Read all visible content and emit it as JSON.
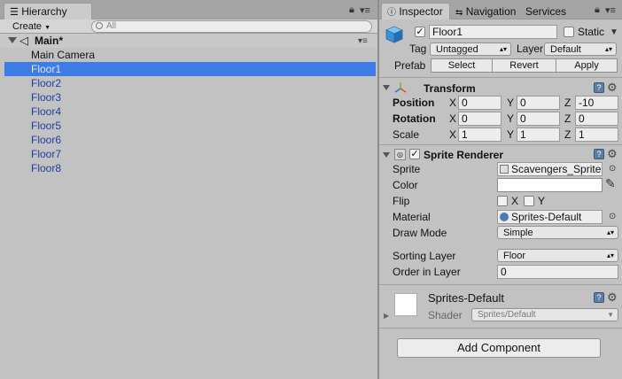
{
  "hierarchy": {
    "tab_label": "Hierarchy",
    "create_label": "Create",
    "search_placeholder": "All",
    "scene_name": "Main*",
    "items": [
      {
        "label": "Main Camera",
        "state": "normal"
      },
      {
        "label": "Floor1",
        "state": "selected"
      },
      {
        "label": "Floor2",
        "state": "prefab"
      },
      {
        "label": "Floor3",
        "state": "prefab"
      },
      {
        "label": "Floor4",
        "state": "prefab"
      },
      {
        "label": "Floor5",
        "state": "prefab"
      },
      {
        "label": "Floor6",
        "state": "prefab"
      },
      {
        "label": "Floor7",
        "state": "prefab"
      },
      {
        "label": "Floor8",
        "state": "prefab"
      }
    ]
  },
  "inspector": {
    "tabs": {
      "inspector": "Inspector",
      "navigation": "Navigation",
      "services": "Services"
    },
    "object": {
      "name": "Floor1",
      "static_label": "Static",
      "tag_label": "Tag",
      "tag_value": "Untagged",
      "layer_label": "Layer",
      "layer_value": "Default",
      "prefab_label": "Prefab",
      "prefab_select": "Select",
      "prefab_revert": "Revert",
      "prefab_apply": "Apply"
    },
    "transform": {
      "title": "Transform",
      "position_label": "Position",
      "rotation_label": "Rotation",
      "scale_label": "Scale",
      "x": "X",
      "y": "Y",
      "z": "Z",
      "position": {
        "x": "0",
        "y": "0",
        "z": "-10"
      },
      "rotation": {
        "x": "0",
        "y": "0",
        "z": "0"
      },
      "scale": {
        "x": "1",
        "y": "1",
        "z": "1"
      }
    },
    "sprite_renderer": {
      "title": "Sprite Renderer",
      "sprite_label": "Sprite",
      "sprite_value": "Scavengers_SpriteS",
      "color_label": "Color",
      "flip_label": "Flip",
      "flip_x": "X",
      "flip_y": "Y",
      "material_label": "Material",
      "material_value": "Sprites-Default",
      "draw_mode_label": "Draw Mode",
      "draw_mode_value": "Simple",
      "sorting_layer_label": "Sorting Layer",
      "sorting_layer_value": "Floor",
      "order_label": "Order in Layer",
      "order_value": "0"
    },
    "material": {
      "name": "Sprites-Default",
      "shader_label": "Shader",
      "shader_value": "Sprites/Default"
    },
    "add_component_label": "Add Component"
  },
  "colors": {
    "selection": "#3e7ce5",
    "prefab_text": "#1d3fa6",
    "panel_bg": "#c2c2c2"
  }
}
